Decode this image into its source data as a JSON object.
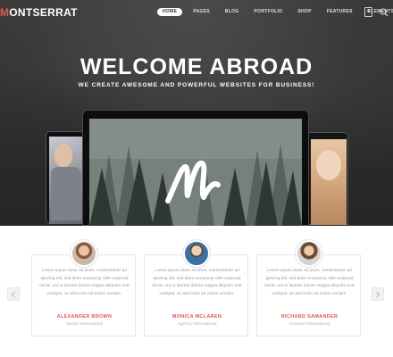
{
  "nav": {
    "logo_mark": "M",
    "logo_text": "ONTSERRAT",
    "items": [
      {
        "label": "Home",
        "active": true
      },
      {
        "label": "Pages",
        "active": false
      },
      {
        "label": "Blog",
        "active": false
      },
      {
        "label": "Portfolio",
        "active": false
      },
      {
        "label": "Shop",
        "active": false
      },
      {
        "label": "Features",
        "active": false
      },
      {
        "label": "Elements",
        "active": false
      }
    ],
    "cart_count": "0"
  },
  "hero": {
    "title": "WELCOME ABROAD",
    "subtitle": "WE CREATE AWESOME AND POWERFUL WEBSITES FOR BUSINESS!"
  },
  "testimonials": [
    {
      "text": "Lorem ipsum dolor sit amet, consectetuer ad ipiscing elit, sed diam nonummy nibh euismod tincid- unt ut laoreet dolore magna aliquam erat volutpat. Ut wisi enim ad minim veniam.",
      "name": "ALEXANDER BROWN",
      "role": "Studio International"
    },
    {
      "text": "Lorem ipsum dolor sit amet, consectetuer ad ipiscing elit, sed diam nonummy nibh euismod tincid- unt ut laoreet dolore magna aliquam erat volutpat. Ut wisi enim ad minim veniam.",
      "name": "MONICA MCLAREN",
      "role": "Agency International"
    },
    {
      "text": "Lorem ipsum dolor sit amet, consectetuer ad ipiscing elit, sed diam nonummy nibh euismod tincid- unt ut laoreet dolore magna aliquam erat volutpat. Ut wisi enim ad minim veniam.",
      "name": "RICHARD SAMANDER",
      "role": "Creative International"
    }
  ],
  "colors": {
    "accent": "#e2574c",
    "hero_bg": "#2d2d2d"
  },
  "icons": {
    "cart": "shopping-bag-icon",
    "search": "search-icon",
    "prev": "chevron-left-icon",
    "next": "chevron-right-icon"
  }
}
